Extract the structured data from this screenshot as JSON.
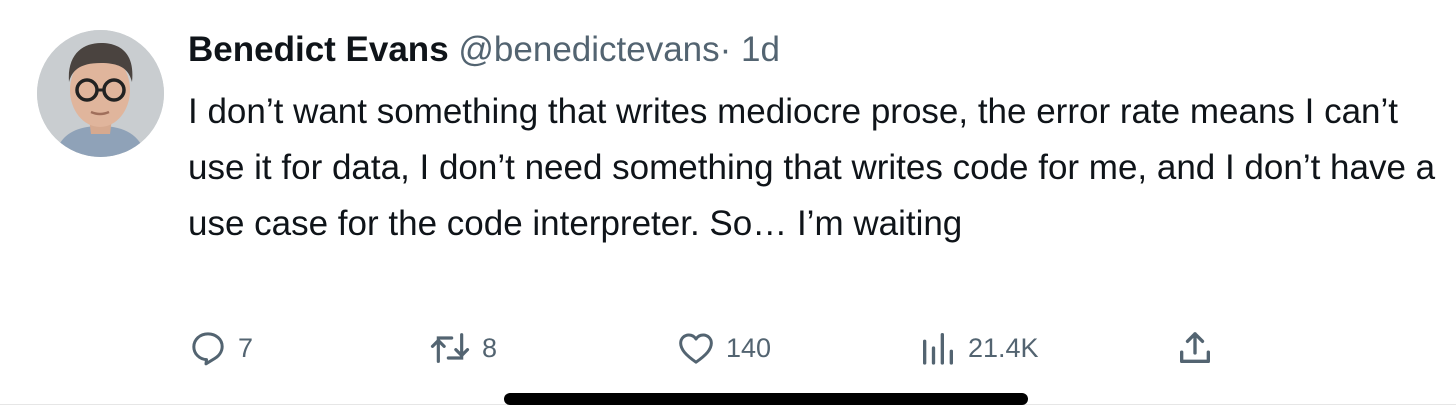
{
  "tweet": {
    "author": {
      "name": "Benedict Evans",
      "handle": "@benedictevans",
      "avatar_icon": "profile-photo"
    },
    "separator": "·",
    "time": "1d",
    "text": "I don’t want something that writes mediocre prose,  the error rate means I can’t use it for data, I don’t need something that writes code for me, and I don’t have a use case for the code interpreter. So… I’m waiting"
  },
  "actions": {
    "reply": {
      "icon": "reply-icon",
      "count": "7"
    },
    "retweet": {
      "icon": "retweet-icon",
      "count": "8"
    },
    "like": {
      "icon": "heart-icon",
      "count": "140"
    },
    "views": {
      "icon": "views-icon",
      "count": "21.4K"
    },
    "share": {
      "icon": "share-icon"
    }
  },
  "colors": {
    "text_primary": "#0f1419",
    "text_secondary": "#536471",
    "background": "#ffffff"
  }
}
